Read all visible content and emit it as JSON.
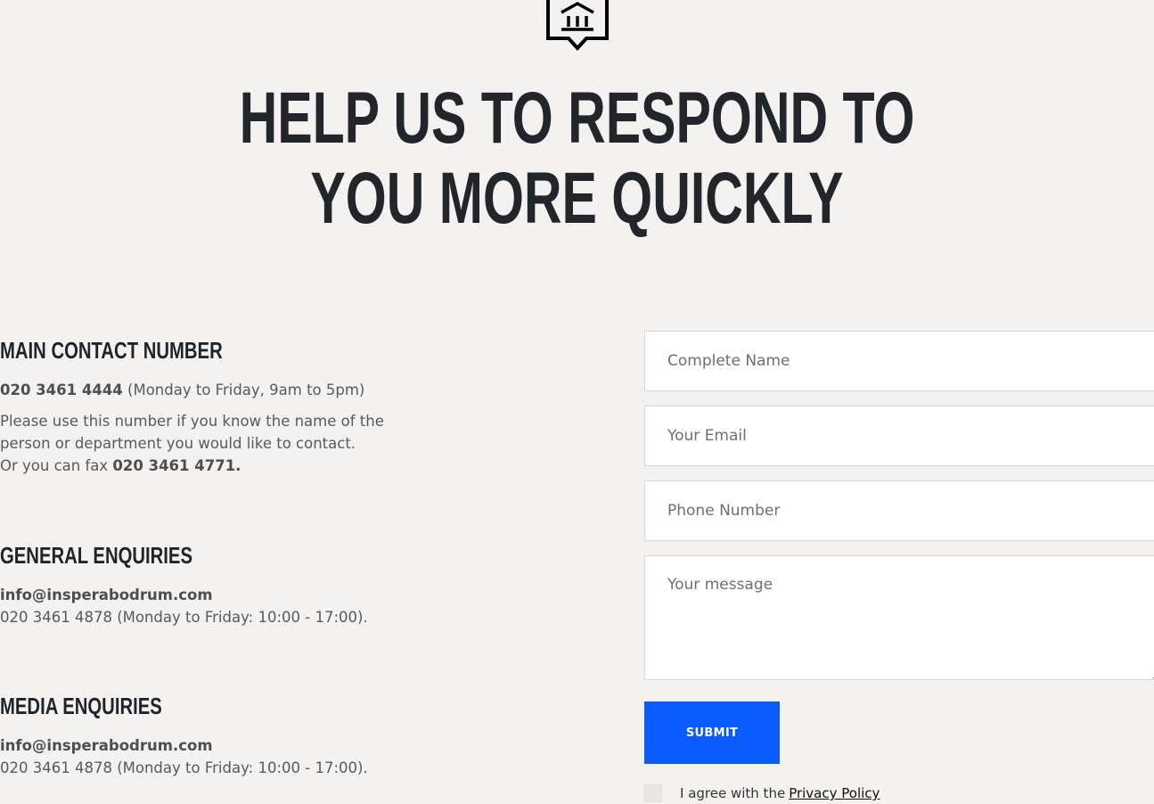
{
  "hero": {
    "title_line1": "Help us to respond to",
    "title_line2": "you more quickly"
  },
  "main_contact": {
    "heading": "Main Contact Number",
    "phone": "020 3461 4444",
    "hours": " (Monday to Friday, 9am to 5pm)",
    "desc_line1": "Please use this number if you know the name of the",
    "desc_line2": "person or department you would like to contact.",
    "fax_prefix": "Or you can fax ",
    "fax_number": "020 3461 4771."
  },
  "general": {
    "heading": "General Enquiries",
    "email": "info@insperabodrum.com",
    "phone_line": "020 3461 4878 (Monday to Friday: 10:00 - 17:00)."
  },
  "media": {
    "heading": "Media Enquiries",
    "email": "info@insperabodrum.com",
    "phone_line": "020 3461 4878 (Monday to Friday: 10:00 - 17:00)."
  },
  "form": {
    "name_placeholder": "Complete Name",
    "email_placeholder": "Your Email",
    "phone_placeholder": "Phone Number",
    "message_placeholder": "Your message",
    "submit_label": "SUBMIT",
    "agree_text": "I agree with the",
    "privacy_link": "Privacy Policy"
  },
  "icons": {
    "logo": "museum-pin-icon"
  }
}
